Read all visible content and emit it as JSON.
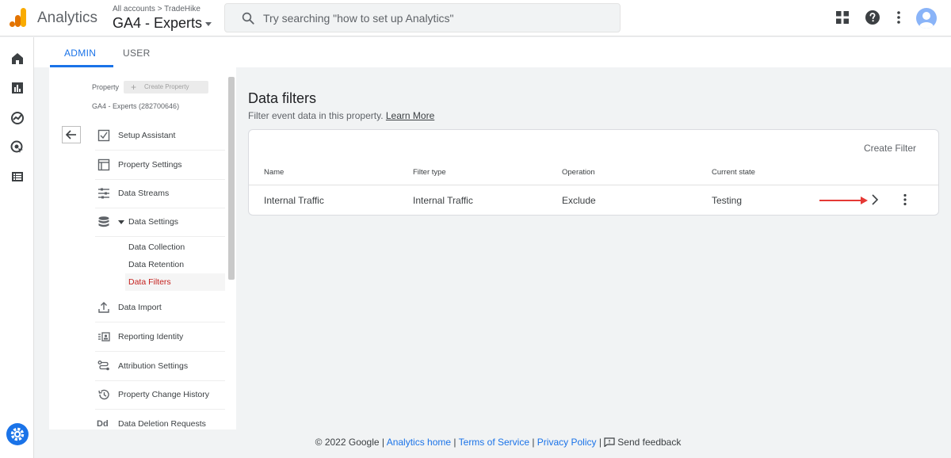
{
  "header": {
    "app_title": "Analytics",
    "breadcrumb_all": "All accounts",
    "breadcrumb_account": "TradeHike",
    "property_name": "GA4 - Experts",
    "search_placeholder": "Try searching \"how to set up Analytics\""
  },
  "tabs": [
    {
      "label": "ADMIN",
      "active": true
    },
    {
      "label": "USER",
      "active": false
    }
  ],
  "nav": {
    "property_label": "Property",
    "create_property_label": "Create Property",
    "property_id": "GA4 - Experts (282700646)",
    "items": [
      {
        "label": "Setup Assistant",
        "icon": "checkbox-icon"
      },
      {
        "label": "Property Settings",
        "icon": "layout-icon"
      },
      {
        "label": "Data Streams",
        "icon": "streams-icon"
      },
      {
        "label": "Data Settings",
        "icon": "database-icon",
        "expanded": true
      },
      {
        "label": "Data Import",
        "icon": "upload-icon"
      },
      {
        "label": "Reporting Identity",
        "icon": "identity-icon"
      },
      {
        "label": "Attribution Settings",
        "icon": "attribution-icon"
      },
      {
        "label": "Property Change History",
        "icon": "history-icon"
      },
      {
        "label": "Data Deletion Requests",
        "icon": "dd-icon",
        "glyph": "Dd"
      }
    ],
    "sub_items": [
      {
        "label": "Data Collection",
        "active": false
      },
      {
        "label": "Data Retention",
        "active": false
      },
      {
        "label": "Data Filters",
        "active": true
      }
    ]
  },
  "main": {
    "title": "Data filters",
    "description": "Filter event data in this property.",
    "learn_more": "Learn More",
    "create_filter": "Create Filter",
    "columns": [
      "Name",
      "Filter type",
      "Operation",
      "Current state"
    ],
    "rows": [
      {
        "name": "Internal Traffic",
        "filter_type": "Internal Traffic",
        "operation": "Exclude",
        "state": "Testing"
      }
    ]
  },
  "footer": {
    "copyright": "© 2022 Google",
    "links": [
      "Analytics home",
      "Terms of Service",
      "Privacy Policy"
    ],
    "feedback": "Send feedback"
  },
  "colors": {
    "accent": "#1a73e8",
    "active_nav": "#c5221f",
    "annotation_arrow": "#e53935"
  }
}
